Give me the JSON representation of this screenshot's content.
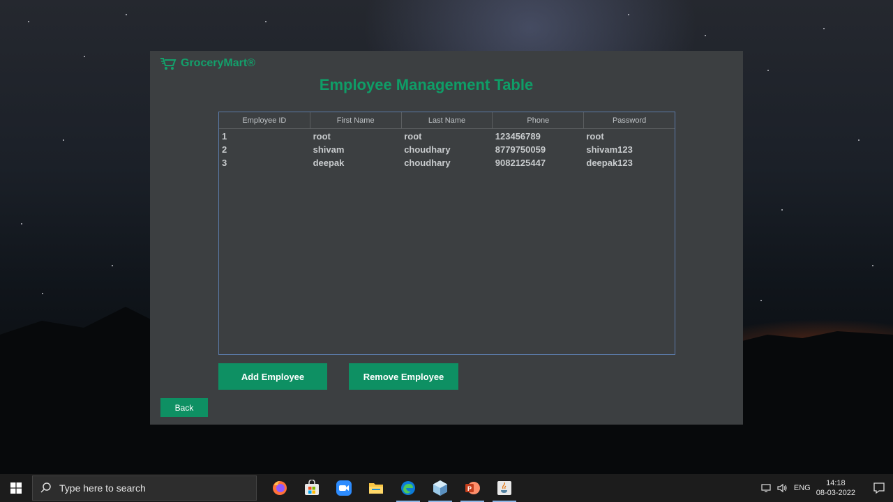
{
  "app": {
    "brand": "GroceryMart®",
    "title": "Employee Management Table"
  },
  "table": {
    "columns": [
      "Employee ID",
      "First Name",
      "Last Name",
      "Phone",
      "Password"
    ],
    "rows": [
      [
        "1",
        "root",
        "root",
        "123456789",
        "root"
      ],
      [
        "2",
        "shivam",
        "choudhary",
        "8779750059",
        "shivam123"
      ],
      [
        "3",
        "deepak",
        "choudhary",
        "9082125447",
        "deepak123"
      ]
    ]
  },
  "buttons": {
    "add": "Add Employee",
    "remove": "Remove Employee",
    "back": "Back"
  },
  "taskbar": {
    "search_placeholder": "Type here to search",
    "apps": [
      "firefox-icon",
      "microsoft-store-icon",
      "zoom-icon",
      "file-explorer-icon",
      "edge-icon",
      "netbeans-icon",
      "powerpoint-icon",
      "java-icon"
    ],
    "language": "ENG",
    "time": "14:18",
    "date": "08-03-2022"
  },
  "colors": {
    "accent": "#0e9063",
    "title_green": "#0f9d67",
    "window_bg": "#3c3f41",
    "table_border": "#5b7aa8"
  }
}
